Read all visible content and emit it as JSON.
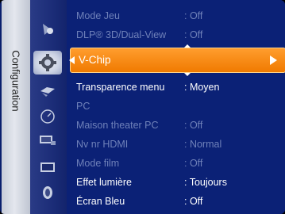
{
  "sidebar": {
    "label": "Configuration"
  },
  "icons": [
    {
      "name": "picture-icon"
    },
    {
      "name": "setup-icon",
      "active": true
    },
    {
      "name": "sound-icon"
    },
    {
      "name": "timer-icon"
    },
    {
      "name": "input-icon"
    },
    {
      "name": "screen-icon"
    },
    {
      "name": "support-icon"
    }
  ],
  "menu": {
    "items": [
      {
        "label": "Mode Jeu",
        "value": ": Off",
        "state": "disabled"
      },
      {
        "label": "DLP® 3D/Dual-View",
        "value": ": Off",
        "state": "disabled"
      },
      {
        "label": "V-Chip",
        "value": "",
        "state": "selected"
      },
      {
        "label": "Transparence menu",
        "value": ": Moyen",
        "state": "enabled"
      },
      {
        "label": "PC",
        "value": "",
        "state": "disabled"
      },
      {
        "label": "Maison theater PC",
        "value": ": Off",
        "state": "disabled"
      },
      {
        "label": "Nv nr HDMI",
        "value": ": Normal",
        "state": "disabled"
      },
      {
        "label": "Mode film",
        "value": ": Off",
        "state": "disabled"
      },
      {
        "label": "Effet lumière",
        "value": ": Toujours",
        "state": "enabled"
      },
      {
        "label": "Écran Bleu",
        "value": ": Off",
        "state": "enabled"
      }
    ]
  },
  "colors": {
    "background": "#0b2176",
    "highlight": "#f07a00",
    "disabled_text": "#6f81b9",
    "enabled_text": "#ffffff"
  }
}
